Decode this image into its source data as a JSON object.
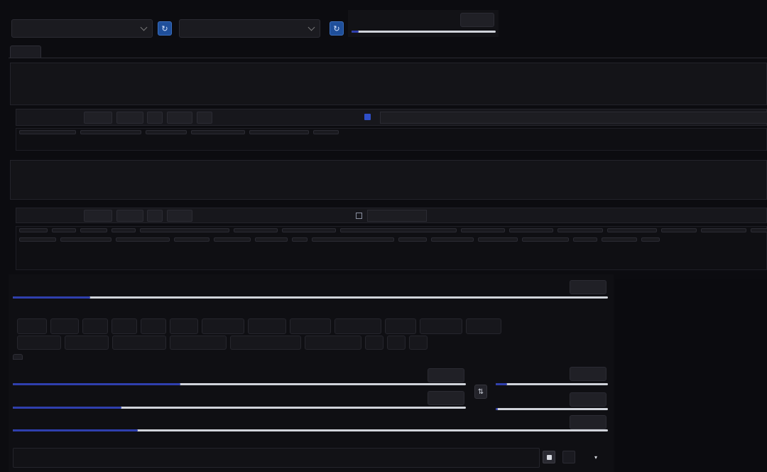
{
  "header": {
    "model": {
      "label": "",
      "value": ""
    },
    "vae": {
      "label": "",
      "value": ""
    },
    "clip_skip": {
      "label": "",
      "value": "",
      "fraction": 0.05
    }
  },
  "tabs": [
    {
      "label": ""
    },
    {
      "label": ""
    },
    {
      "label": ""
    },
    {
      "label": ""
    },
    {
      "label": ""
    },
    {
      "label": ""
    },
    {
      "label": ""
    },
    {
      "label": ""
    },
    {
      "label": ""
    },
    {
      "label": ""
    },
    {
      "label": ""
    },
    {
      "label": ""
    },
    {
      "label": ""
    }
  ],
  "prompt": {
    "text": ""
  },
  "positive": {
    "label": "",
    "count": "",
    "tools": [
      "",
      "",
      "",
      "",
      ""
    ],
    "search_placeholder": "",
    "tags": [
      {
        "name": "",
        "sub": ""
      },
      {
        "name": "",
        "sub": ""
      },
      {
        "name": "",
        "sub": ""
      },
      {
        "name": "",
        "sub": ""
      },
      {
        "name": "",
        "sub": ""
      },
      {
        "name": "",
        "sub": ""
      }
    ]
  },
  "negative_prompt": {
    "text": ""
  },
  "negative": {
    "label": "",
    "count": "",
    "tools": [
      "",
      "",
      "",
      "",
      ""
    ],
    "search_label": "",
    "tags_row1": [
      {
        "name": "",
        "sub": ""
      },
      {
        "name": "",
        "sub": ""
      },
      {
        "name": "",
        "sub": ""
      },
      {
        "name": "",
        "sub": ""
      },
      {
        "name": "",
        "sub": ""
      },
      {
        "name": "",
        "sub": ""
      },
      {
        "name": "",
        "sub": ""
      },
      {
        "name": "",
        "sub": ""
      },
      {
        "name": "",
        "sub": ""
      },
      {
        "name": "",
        "sub": ""
      },
      {
        "name": "",
        "sub": ""
      },
      {
        "name": "",
        "sub": ""
      },
      {
        "name": "",
        "sub": ""
      },
      {
        "name": "",
        "sub": ""
      },
      {
        "name": "",
        "sub": ""
      }
    ],
    "tags_row2": [
      {
        "name": "",
        "sub": ""
      },
      {
        "name": "",
        "sub": ""
      },
      {
        "name": "",
        "sub": ""
      },
      {
        "name": "",
        "sub": ""
      },
      {
        "name": "",
        "sub": ""
      },
      {
        "name": "",
        "sub": ""
      },
      {
        "name": "",
        "sub": ""
      },
      {
        "name": "",
        "sub": ""
      },
      {
        "name": "",
        "sub": ""
      },
      {
        "name": "",
        "sub": ""
      },
      {
        "name": "",
        "sub": ""
      },
      {
        "name": "",
        "sub": ""
      },
      {
        "name": "",
        "sub": ""
      },
      {
        "name": "",
        "sub": ""
      },
      {
        "name": "",
        "sub": ""
      }
    ]
  },
  "steps": {
    "label": "",
    "value": "",
    "fraction": 0.13
  },
  "sampler": {
    "label": "",
    "row1": [
      "",
      "",
      "",
      "",
      "",
      "",
      "",
      "",
      "",
      "",
      "",
      "",
      "",
      ""
    ],
    "row2": [
      "",
      "",
      "",
      "",
      "",
      "",
      "",
      "",
      "",
      "",
      "",
      ""
    ],
    "selected": ""
  },
  "subtabs": [
    {
      "label": ""
    },
    {
      "label": ""
    },
    {
      "label": ""
    }
  ],
  "width": {
    "label": "",
    "value": "",
    "fraction": 0.37
  },
  "height": {
    "label": "",
    "value": "",
    "fraction": 0.24
  },
  "swap_icon": "⇅",
  "batch_count": {
    "label": "",
    "value": "",
    "fraction": 0.1
  },
  "batch_size": {
    "label": "",
    "value": "",
    "fraction": 0.02
  },
  "cfg": {
    "label": "",
    "value": "",
    "fraction": 0.21
  },
  "seed": {
    "label": "",
    "value": ""
  },
  "seed_buttons": [
    "",
    "",
    ""
  ],
  "colors": {
    "accent": "#2f3fae",
    "refresh": "#1f4f9a",
    "bg": "#0c0c10"
  }
}
